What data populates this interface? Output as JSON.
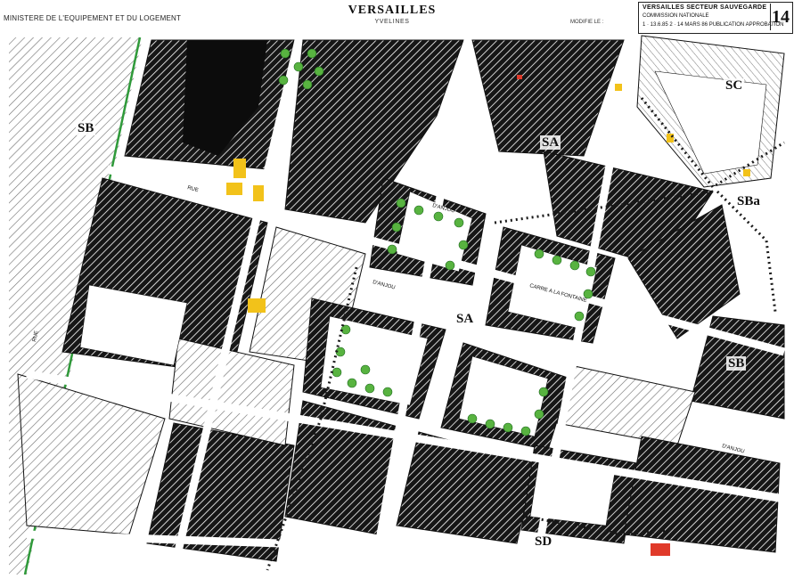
{
  "header": {
    "ministry": "MINISTERE DE L'EQUIPEMENT ET DU LOGEMENT",
    "city": "VERSAILLES",
    "department": "YVELINES",
    "modified": "MODIFIE LE :",
    "cartouche": {
      "title": "VERSAILLES SECTEUR SAUVEGARDE",
      "line2": "COMMISSION NATIONALE",
      "line3": "1 · 13.6.85   2 · 14 MARS 86   PUBLICATION   APPROBATION",
      "sheet": "14"
    }
  },
  "zones": [
    "SB",
    "SC",
    "SBa",
    "SA",
    "SA",
    "SB",
    "SD"
  ],
  "streets": [
    "RUE",
    "D'ANJOU",
    "D'ANJOU",
    "CARRE A LA FONTAINE",
    "D'ANJOU",
    "RUE"
  ],
  "colors": {
    "built": "#161616",
    "hatch": "#6d6d6d",
    "road": "#ffffff",
    "water": "#0c0c0c",
    "tree": "#58b340",
    "highlight_yellow": "#f2c21a",
    "highlight_red": "#e03a2a",
    "green_line": "#2f9a3a",
    "dotted_boundary": "#1a1a1a"
  }
}
